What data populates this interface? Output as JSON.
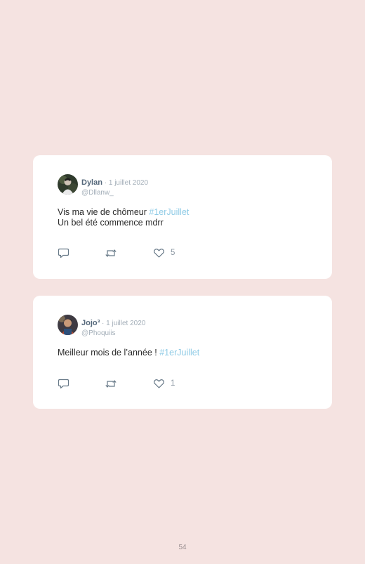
{
  "tweets": [
    {
      "name": "Dylan",
      "date": " · 1 juillet 2020",
      "handle": "@Dllanw_",
      "text_line1": "Vis ma vie de chômeur ",
      "hashtag": "#1erJuillet",
      "text_line2": "Un bel été commence mdrr",
      "likes": "5"
    },
    {
      "name": "Jojo³",
      "date": " · 1 juillet 2020",
      "handle": "@Phoquiis",
      "text_line1": "Meilleur mois de l’année ! ",
      "hashtag": "#1erJuillet",
      "likes": "1"
    }
  ],
  "page_number": "54",
  "colors": {
    "background": "#f5e3e1",
    "card": "#ffffff",
    "hashtag": "#8fcbe6",
    "name": "#54677a",
    "muted": "#a3aeb8"
  }
}
